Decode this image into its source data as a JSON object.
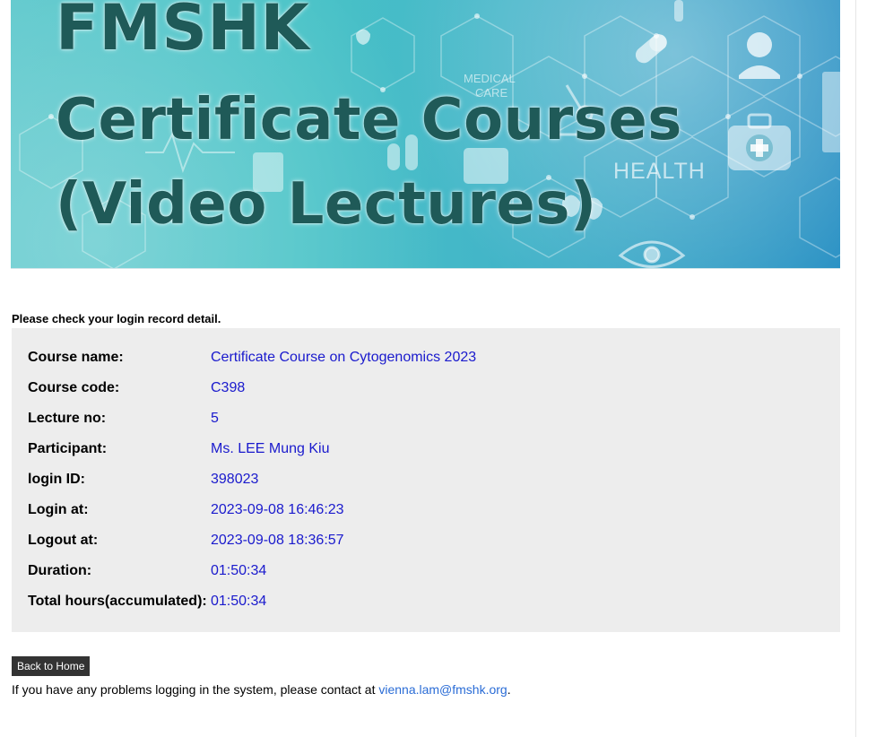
{
  "banner": {
    "line1": "FMSHK",
    "line2": "Certificate Courses",
    "line3": "(Video Lectures)",
    "decor_text": "HEALTH",
    "decor_small_text_1": "MEDICAL",
    "decor_small_text_2": "CARE"
  },
  "instruction": "Please check your login record detail.",
  "record": {
    "rows": [
      {
        "label": "Course name:",
        "value": "Certificate Course on Cytogenomics 2023"
      },
      {
        "label": "Course code:",
        "value": "C398"
      },
      {
        "label": "Lecture no:",
        "value": "5"
      },
      {
        "label": "Participant:",
        "value": "Ms. LEE Mung Kiu"
      },
      {
        "label": "login ID:",
        "value": "398023"
      },
      {
        "label": "Login at:",
        "value": "2023-09-08 16:46:23"
      },
      {
        "label": "Logout at:",
        "value": "2023-09-08 18:36:57"
      },
      {
        "label": "Duration:",
        "value": "01:50:34"
      },
      {
        "label": "Total hours(accumulated):",
        "value": "01:50:34"
      }
    ]
  },
  "actions": {
    "back_label": "Back to Home"
  },
  "contact": {
    "prefix": "If you have any problems logging in the system, please contact at ",
    "email": "vienna.lam@fmshk.org",
    "suffix": "."
  },
  "colors": {
    "banner_text": "#1f5a58",
    "value_text": "#1a1acd",
    "box_background": "#ededed",
    "button_background": "#333333",
    "link": "#2a6cd6"
  },
  "icons": [
    "pill-icon",
    "doctor-icon",
    "medical-kit-icon",
    "microscope-icon",
    "eye-icon",
    "heartbeat-icon",
    "drop-icon",
    "thermometer-icon",
    "clipboard-icon"
  ]
}
